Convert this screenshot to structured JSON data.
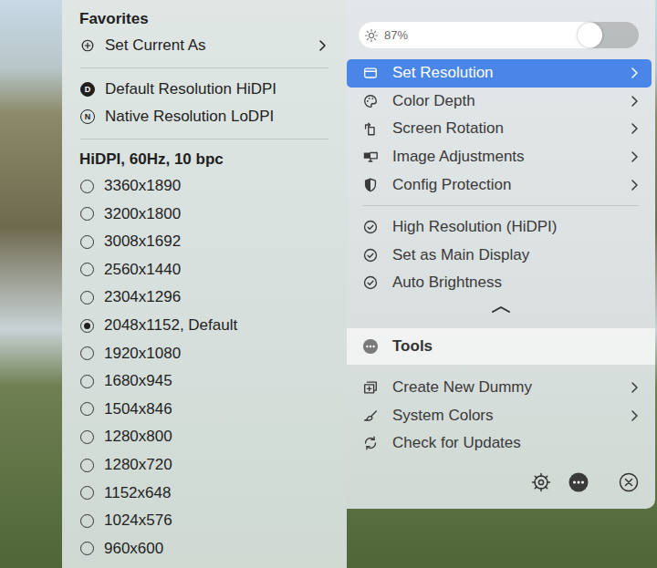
{
  "favorites": {
    "title": "Favorites",
    "set_current": {
      "label": "Set Current As",
      "submenu": true
    },
    "presets": [
      {
        "badge": "D",
        "label": "Default Resolution HiDPI",
        "filled": true
      },
      {
        "badge": "N",
        "label": "Native Resolution LoDPI",
        "filled": false
      }
    ]
  },
  "resolutions": {
    "title": "HiDPI, 60Hz, 10 bpc",
    "items": [
      {
        "label": "3360x1890",
        "selected": false
      },
      {
        "label": "3200x1800",
        "selected": false
      },
      {
        "label": "3008x1692",
        "selected": false
      },
      {
        "label": "2560x1440",
        "selected": false
      },
      {
        "label": "2304x1296",
        "selected": false
      },
      {
        "label": "2048x1152, Default",
        "selected": true
      },
      {
        "label": "1920x1080",
        "selected": false
      },
      {
        "label": "1680x945",
        "selected": false
      },
      {
        "label": "1504x846",
        "selected": false
      },
      {
        "label": "1280x800",
        "selected": false
      },
      {
        "label": "1280x720",
        "selected": false
      },
      {
        "label": "1152x648",
        "selected": false
      },
      {
        "label": "1024x576",
        "selected": false
      },
      {
        "label": "960x600",
        "selected": false
      }
    ]
  },
  "brightness": {
    "level": 0.87,
    "reading": "87%"
  },
  "menu": [
    {
      "label": "Set Resolution",
      "submenu": true,
      "highlighted": true
    },
    {
      "label": "Color Depth",
      "submenu": true,
      "highlighted": false
    },
    {
      "label": "Screen Rotation",
      "submenu": true,
      "highlighted": false
    },
    {
      "label": "Image Adjustments",
      "submenu": true,
      "highlighted": false
    },
    {
      "label": "Config Protection",
      "submenu": true,
      "highlighted": false
    }
  ],
  "options": [
    {
      "label": "High Resolution (HiDPI)",
      "checked": true
    },
    {
      "label": "Set as Main Display",
      "checked": true
    },
    {
      "label": "Auto Brightness",
      "checked": true
    }
  ],
  "tools": {
    "label": "Tools",
    "expanded": true,
    "items": [
      {
        "label": "Create New Dummy",
        "submenu": true
      },
      {
        "label": "System Colors",
        "submenu": true
      },
      {
        "label": "Check for Updates",
        "submenu": false
      }
    ]
  }
}
